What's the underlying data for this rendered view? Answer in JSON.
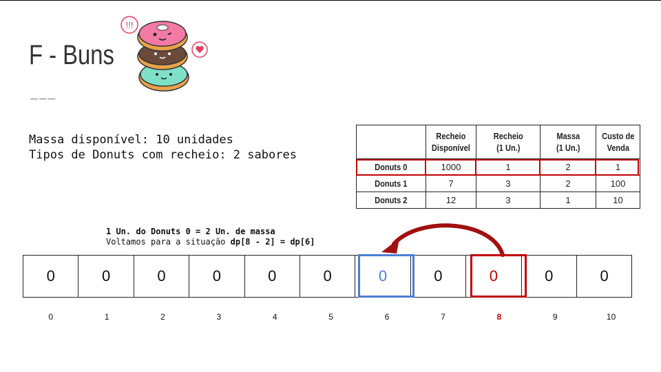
{
  "title": "F - Buns",
  "divider": "___",
  "info": {
    "line1": "Massa disponível: 10 unidades",
    "line2": "Tipos de Donuts com recheio: 2 sabores"
  },
  "table": {
    "headers": [
      "",
      "Recheio Disponível",
      "Recheio (1 Un.)",
      "Massa (1 Un.)",
      "Custo de Venda"
    ],
    "header_lines": [
      [
        "",
        ""
      ],
      [
        "Recheio",
        "Disponível"
      ],
      [
        "Recheio",
        "(1 Un.)"
      ],
      [
        "Massa",
        "(1 Un.)"
      ],
      [
        "Custo de",
        "Venda"
      ]
    ],
    "rows": [
      {
        "name": "Donuts 0",
        "values": [
          "1000",
          "1",
          "2",
          "1"
        ],
        "highlighted": true
      },
      {
        "name": "Donuts 1",
        "values": [
          "7",
          "3",
          "2",
          "100"
        ],
        "highlighted": false
      },
      {
        "name": "Donuts 2",
        "values": [
          "12",
          "3",
          "1",
          "10"
        ],
        "highlighted": false
      }
    ]
  },
  "note": {
    "line1": "1 Un. do Donuts 0 = 2 Un. de massa",
    "line2_prefix": "Voltamos para a situação ",
    "line2_bold": "dp[8 - 2] = dp[6]"
  },
  "dp": {
    "values": [
      "0",
      "0",
      "0",
      "0",
      "0",
      "0",
      "0",
      "0",
      "0",
      "0",
      "0"
    ],
    "indices": [
      "0",
      "1",
      "2",
      "3",
      "4",
      "5",
      "6",
      "7",
      "8",
      "9",
      "10"
    ],
    "highlight_source_index": 8,
    "highlight_target_index": 6
  },
  "colors": {
    "red": "#c00000",
    "blue": "#4a7fd4",
    "arrow": "#a01010"
  },
  "icons": {
    "donut_stack": "stacked-donuts-illustration"
  }
}
